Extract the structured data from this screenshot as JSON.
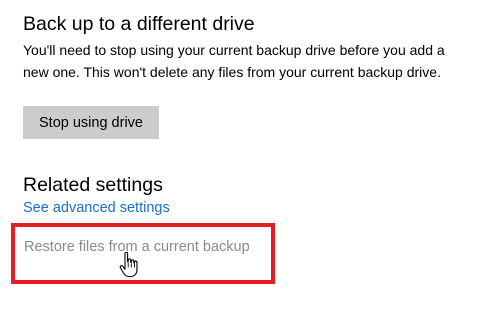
{
  "backup_section": {
    "title": "Back up to a different drive",
    "description": "You'll need to stop using your current backup drive before you add a new one. This won't delete any files from your current backup drive.",
    "stop_button_label": "Stop using drive"
  },
  "related_section": {
    "title": "Related settings",
    "advanced_link": "See advanced settings",
    "restore_link": "Restore files from a current backup"
  },
  "colors": {
    "link": "#1a6fc9",
    "disabled_link": "#8a8a8a",
    "highlight": "#e81c24",
    "button_bg": "#cccccc"
  },
  "cursor_icon": "hand-pointer-icon"
}
